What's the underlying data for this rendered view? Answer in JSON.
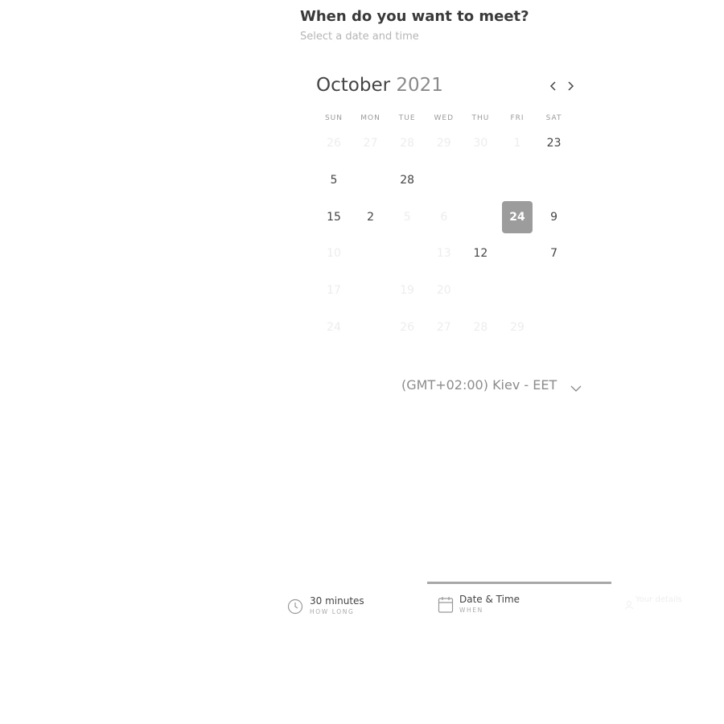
{
  "header": {
    "title": "When do you want to meet?",
    "subtitle": "Select a date and time"
  },
  "calendar": {
    "month": "October",
    "year": "2021",
    "weekdays": [
      "SUN",
      "MON",
      "TUE",
      "WED",
      "THU",
      "FRI",
      "SAT"
    ],
    "days": [
      {
        "label": "26",
        "state": "faded"
      },
      {
        "label": "27",
        "state": "faded"
      },
      {
        "label": "28",
        "state": "faded"
      },
      {
        "label": "29",
        "state": "faded"
      },
      {
        "label": "30",
        "state": "faded"
      },
      {
        "label": "1",
        "state": "faded"
      },
      {
        "label": "23",
        "state": "available"
      },
      {
        "label": "5",
        "state": "available"
      },
      {
        "label": "",
        "state": "empty"
      },
      {
        "label": "28",
        "state": "available"
      },
      {
        "label": "",
        "state": "empty"
      },
      {
        "label": "",
        "state": "empty"
      },
      {
        "label": "",
        "state": "empty"
      },
      {
        "label": "",
        "state": "empty"
      },
      {
        "label": "15",
        "state": "available"
      },
      {
        "label": "2",
        "state": "available"
      },
      {
        "label": "5",
        "state": "faded"
      },
      {
        "label": "6",
        "state": "faded"
      },
      {
        "label": "",
        "state": "empty"
      },
      {
        "label": "24",
        "state": "selected"
      },
      {
        "label": "9",
        "state": "available"
      },
      {
        "label": "10",
        "state": "faded"
      },
      {
        "label": "",
        "state": "empty"
      },
      {
        "label": "",
        "state": "empty"
      },
      {
        "label": "13",
        "state": "faded"
      },
      {
        "label": "12",
        "state": "available"
      },
      {
        "label": "",
        "state": "empty"
      },
      {
        "label": "7",
        "state": "available"
      },
      {
        "label": "17",
        "state": "faded"
      },
      {
        "label": "",
        "state": "empty"
      },
      {
        "label": "19",
        "state": "faded"
      },
      {
        "label": "20",
        "state": "faded"
      },
      {
        "label": "",
        "state": "empty"
      },
      {
        "label": "",
        "state": "empty"
      },
      {
        "label": "",
        "state": "empty"
      },
      {
        "label": "24",
        "state": "faded"
      },
      {
        "label": "",
        "state": "empty"
      },
      {
        "label": "26",
        "state": "faded"
      },
      {
        "label": "27",
        "state": "faded"
      },
      {
        "label": "28",
        "state": "faded"
      },
      {
        "label": "29",
        "state": "faded"
      },
      {
        "label": "",
        "state": "empty"
      }
    ]
  },
  "timezone": {
    "label": "(GMT+02:00) Kiev - EET"
  },
  "steps": [
    {
      "label": "30 minutes",
      "sub": "How long",
      "icon": "clock-icon"
    },
    {
      "label": "Date & Time",
      "sub": "When",
      "icon": "calendar-icon"
    },
    {
      "label": "Your details",
      "sub": "",
      "icon": "user-icon"
    }
  ],
  "colors": {
    "accent_selected": "#9c9c9c",
    "progress": "#a8a8a8"
  }
}
